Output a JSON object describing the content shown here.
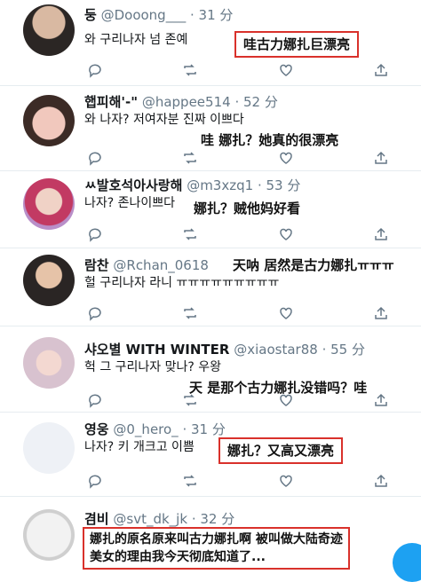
{
  "tweets": [
    {
      "name": "둥",
      "handle": "@Dooong___",
      "time": "· 31 分",
      "text": "와 구리나자 넘 존예",
      "caption": "哇古力娜扎巨漂亮"
    },
    {
      "name": "햅피해'-\"",
      "handle": "@happee514",
      "time": "· 52 分",
      "text": "와 나자? 저여자분 진짜 이쁘다",
      "caption": "哇 娜扎？她真的很漂亮"
    },
    {
      "name": "ㅆ발호석아사랑해",
      "handle": "@m3xzq1",
      "time": "· 53 分",
      "text": "나자? 존나이쁘다",
      "caption": "娜扎？贼他妈好看"
    },
    {
      "name": "람찬",
      "handle": "@Rchan_0618",
      "time": "",
      "text": "헐 구리나자 라니 ㅠㅠㅠㅠㅠㅠㅠㅠㅠ",
      "caption": "天呐 居然是古力娜扎ㅠㅠㅠ"
    },
    {
      "name": "샤오별 WITH WINTER",
      "handle": "@xiaostar88",
      "time": "· 55 分",
      "text": "헉 그 구리나자 맞나? 우왕",
      "caption": "天 是那个古力娜扎没错吗？哇"
    },
    {
      "name": "영웅",
      "handle": "@0_hero_",
      "time": "· 31 分",
      "text": "나자? 키 개크고 이쁨",
      "caption": "娜扎？又高又漂亮"
    },
    {
      "name": "겸비",
      "handle": "@svt_dk_jk",
      "time": "· 32 分",
      "text": "",
      "caption_line1": "娜扎的原名原来叫古力娜扎啊 被叫做大陆奇迹",
      "caption_line2": "美女的理由我今天彻底知道了..."
    }
  ],
  "colors": {
    "accent": "#1da1f2",
    "highlight": "#d9312b",
    "muted": "#657786"
  },
  "icons": [
    "reply-icon",
    "retweet-icon",
    "like-icon",
    "share-icon"
  ]
}
